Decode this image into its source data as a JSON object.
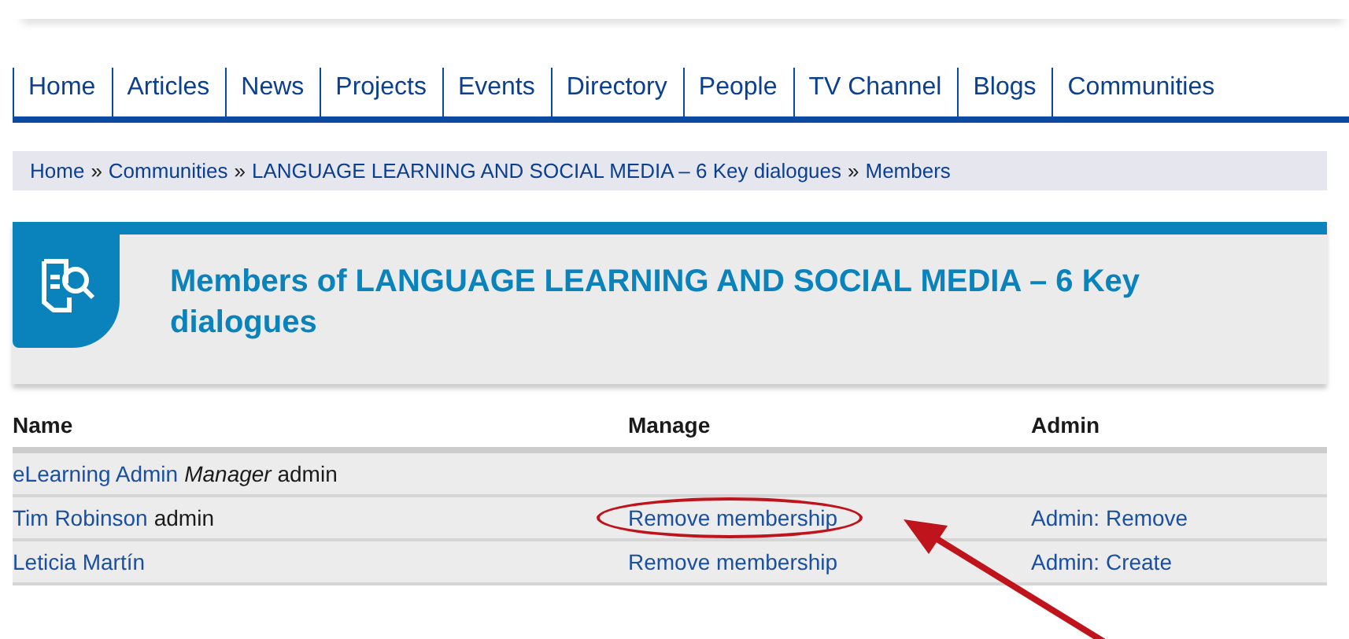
{
  "nav": [
    {
      "label": "Home"
    },
    {
      "label": "Articles"
    },
    {
      "label": "News"
    },
    {
      "label": "Projects"
    },
    {
      "label": "Events"
    },
    {
      "label": "Directory"
    },
    {
      "label": "People"
    },
    {
      "label": "TV Channel"
    },
    {
      "label": "Blogs"
    },
    {
      "label": "Communities"
    }
  ],
  "breadcrumb": {
    "links": [
      "Home",
      "Communities",
      "LANGUAGE LEARNING AND SOCIAL MEDIA – 6 Key dialogues",
      "Members"
    ],
    "separator": "»"
  },
  "header": {
    "title": "Members of LANGUAGE LEARNING AND SOCIAL MEDIA – 6 Key dialogues"
  },
  "table": {
    "columns": [
      "Name",
      "Manage",
      "Admin"
    ],
    "rows": [
      {
        "name": "eLearning Admin",
        "note": "*Manager* admin",
        "circled": false
      },
      {
        "name": "Tim Robinson",
        "note": "admin",
        "manage": "Remove membership",
        "admin": "Admin: Remove",
        "circled": true
      },
      {
        "name": "Leticia Martín",
        "manage": "Remove membership",
        "admin": "Admin: Create",
        "circled": false
      }
    ]
  }
}
